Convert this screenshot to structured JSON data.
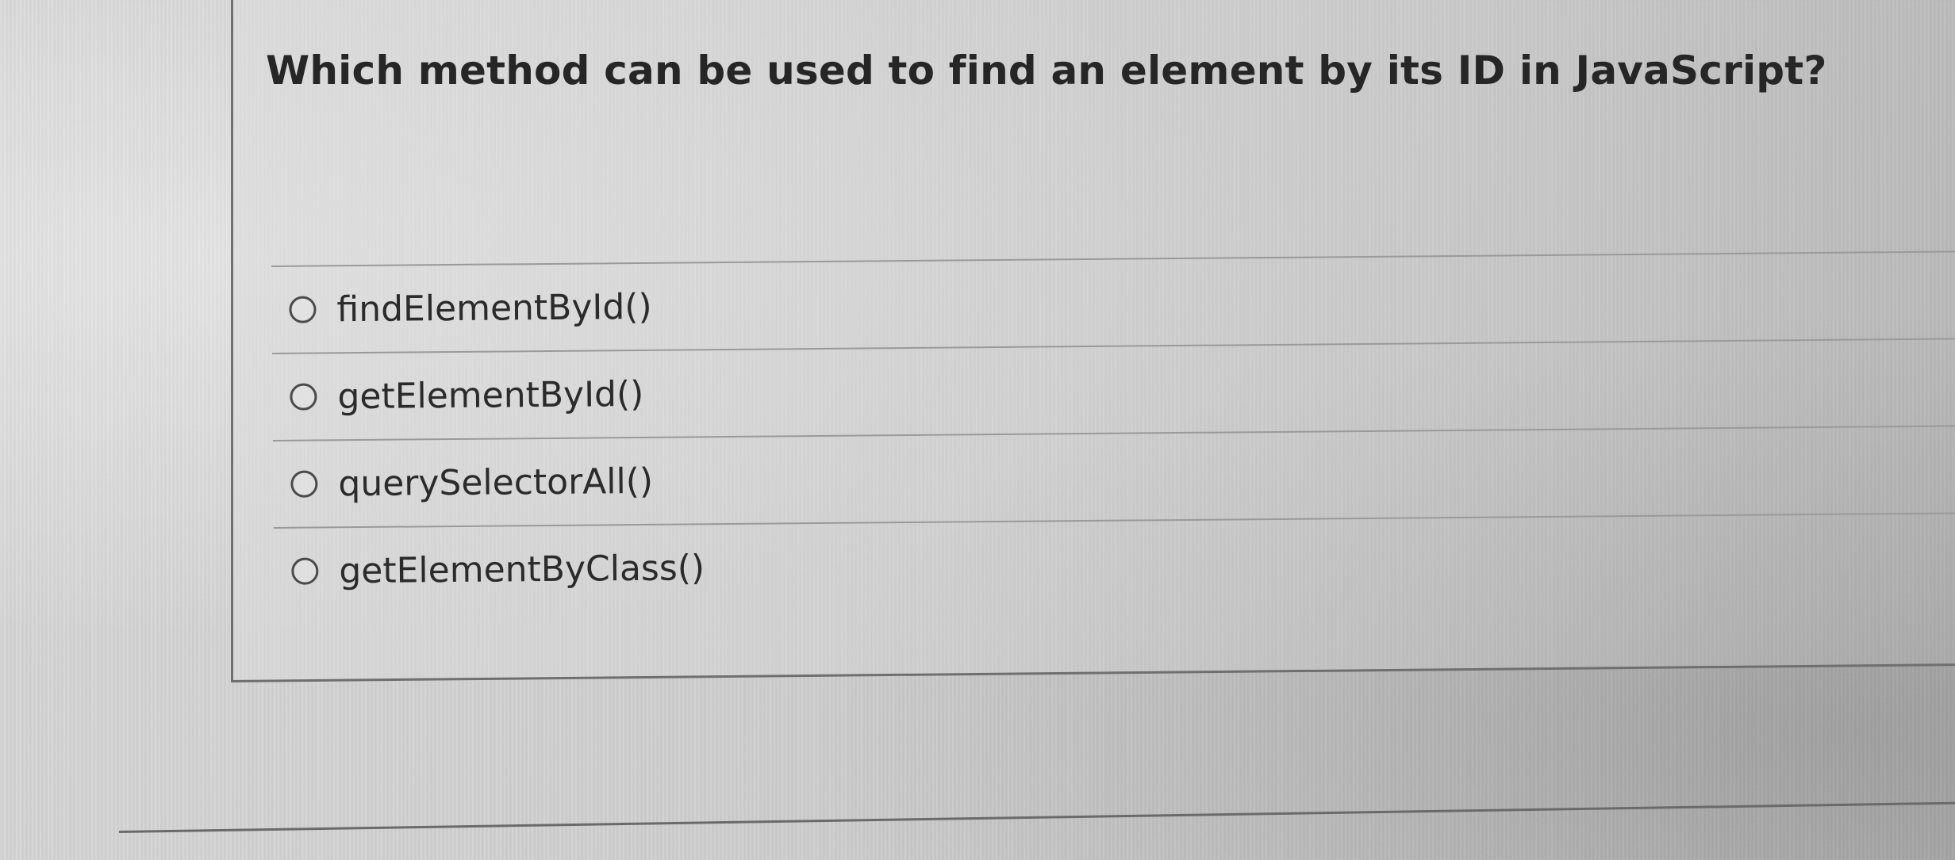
{
  "question": {
    "text": "Which method can be used to find an element by its ID in JavaScript?"
  },
  "options": [
    {
      "label": "findElementById()",
      "selected": false
    },
    {
      "label": "getElementById()",
      "selected": false
    },
    {
      "label": "querySelectorAll()",
      "selected": false
    },
    {
      "label": "getElementByClass()",
      "selected": false
    }
  ],
  "colors": {
    "text": "#262626",
    "divider": "#9a9a9a",
    "border": "#6f6f6f",
    "background": "#d1d1d1"
  }
}
